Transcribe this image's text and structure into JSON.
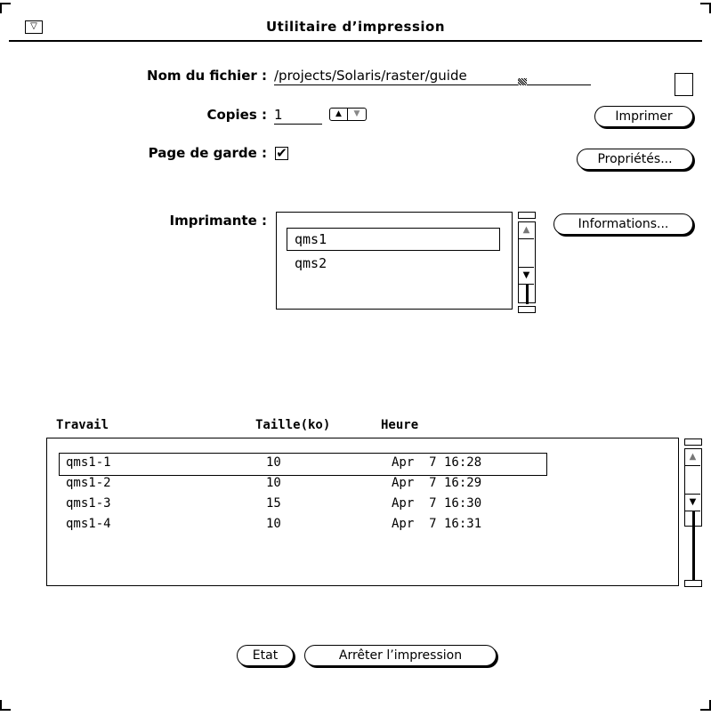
{
  "window": {
    "title": "Utilitaire d’impression",
    "menu_glyph": "▽"
  },
  "form": {
    "filename_label": "Nom du fichier :",
    "filename_value": "/projects/Solaris/raster/guide",
    "copies_label": "Copies :",
    "copies_value": "1",
    "cover_label": "Page de garde :",
    "cover_checked_glyph": "✔",
    "printer_label": "Imprimante :"
  },
  "buttons": {
    "print": "Imprimer",
    "properties": "Propriétés...",
    "info": "Informations...",
    "status": "Etat",
    "stop": "Arrêter l’impression"
  },
  "printers": [
    {
      "name": "qms1"
    },
    {
      "name": "qms2"
    }
  ],
  "jobs": {
    "headers": {
      "job": "Travail",
      "size": "Taille(ko)",
      "time": "Heure"
    },
    "rows": [
      {
        "job": "qms1-1",
        "size": "10",
        "time": "Apr  7 16:28"
      },
      {
        "job": "qms1-2",
        "size": "10",
        "time": "Apr  7 16:29"
      },
      {
        "job": "qms1-3",
        "size": "15",
        "time": "Apr  7 16:30"
      },
      {
        "job": "qms1-4",
        "size": "10",
        "time": "Apr  7 16:31"
      }
    ]
  },
  "icons": {
    "scroll_up": "▲",
    "scroll_down": "▼",
    "spin_up": "▲",
    "spin_down": "▼"
  }
}
